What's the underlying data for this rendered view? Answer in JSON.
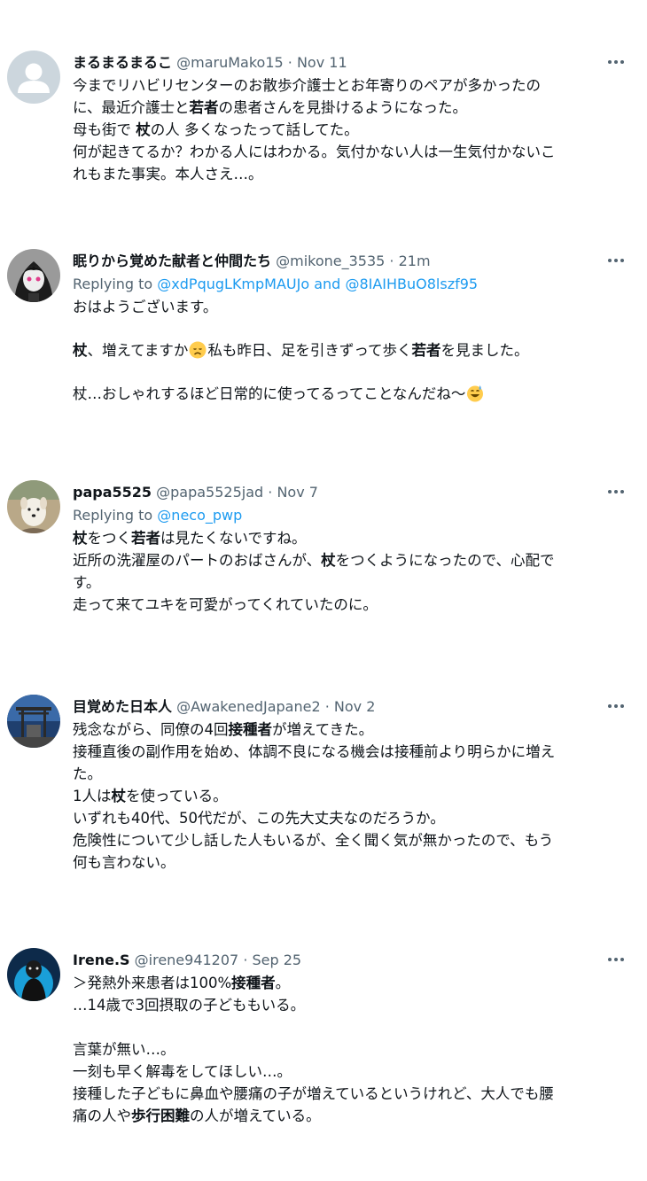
{
  "tweets": [
    {
      "name": "まるまるまるこ",
      "handle": "@maruMako15",
      "separator": "·",
      "time": "Nov 11",
      "lines": [
        [
          "今までリハビリセンターのお散歩介護士とお年寄りのペアが多かったの"
        ],
        [
          "に、最近介護士と",
          "若者",
          "の患者さんを見掛けるようになった。"
        ],
        [
          "母も街で ",
          "杖",
          "の人 多くなったって話してた。"
        ],
        [
          "何が起きてるか？わかる人にはわかる。気付かない人は一生気付かないこ"
        ],
        [
          "れもまた事実。本人さえ…。"
        ]
      ]
    },
    {
      "name": "眠りから覚めた献者と仲間たち",
      "handle": "@mikone_3535",
      "separator": "·",
      "time": "21m",
      "replying_prefix": "Replying to",
      "replying_user1": "@xdPqugLKmpMAUJo",
      "replying_and": "and",
      "replying_user2": "@8IAIHBuO8lszf95",
      "line1": "おはようございます。",
      "line2_a": "杖",
      "line2_b": "、増えてますか",
      "line2_c": "私も昨日、足を引きずって歩く",
      "line2_d": "若者",
      "line2_e": "を見ました。",
      "line3": "杖…おしゃれするほど日常的に使ってるってことなんだね〜",
      "emoji_names": [
        "disappointed-face-emoji",
        "grinning-sweat-emoji"
      ]
    },
    {
      "name": "papa5525",
      "handle": "@papa5525jad",
      "separator": "·",
      "time": "Nov 7",
      "replying_prefix": "Replying to",
      "replying_user1": "@neco_pwp",
      "lines": [
        [
          "杖",
          "をつく",
          "若者",
          "は見たくないですね。"
        ],
        [
          "近所の洗濯屋のパートのおばさんが、",
          "杖",
          "をつくようになったので、心配で"
        ],
        [
          "す。"
        ],
        [
          "走って来てユキを可愛がってくれていたのに。"
        ]
      ]
    },
    {
      "name": "目覚めた日本人",
      "handle": "@AwakenedJapane2",
      "separator": "·",
      "time": "Nov 2",
      "lines": [
        [
          "残念ながら、同僚の4回",
          "接種者",
          "が増えてきた。"
        ],
        [
          "接種直後の副作用を始め、体調不良になる機会は接種前より明らかに増え"
        ],
        [
          "た。"
        ],
        [
          "1人は",
          "杖",
          "を使っている。"
        ],
        [
          "いずれも40代、50代だが、この先大丈夫なのだろうか。"
        ],
        [
          "危険性について少し話した人もいるが、全く聞く気が無かったので、もう"
        ],
        [
          "何も言わない。"
        ]
      ]
    },
    {
      "name": "Irene.S",
      "handle": "@irene941207",
      "separator": "·",
      "time": "Sep 25",
      "lines": [
        [
          "＞発熱外来患者は100%",
          "接種者",
          "。"
        ],
        [
          "…14歳で3回摂取の子どももいる。"
        ],
        [
          ""
        ],
        [
          "言葉が無い…。"
        ],
        [
          "一刻も早く解毒をしてほしい…。"
        ],
        [
          "接種した子どもに鼻血や腰痛の子が増えているというけれど、大人でも腰"
        ],
        [
          "痛の人や",
          "歩行困難",
          "の人が増えている。"
        ]
      ]
    }
  ]
}
